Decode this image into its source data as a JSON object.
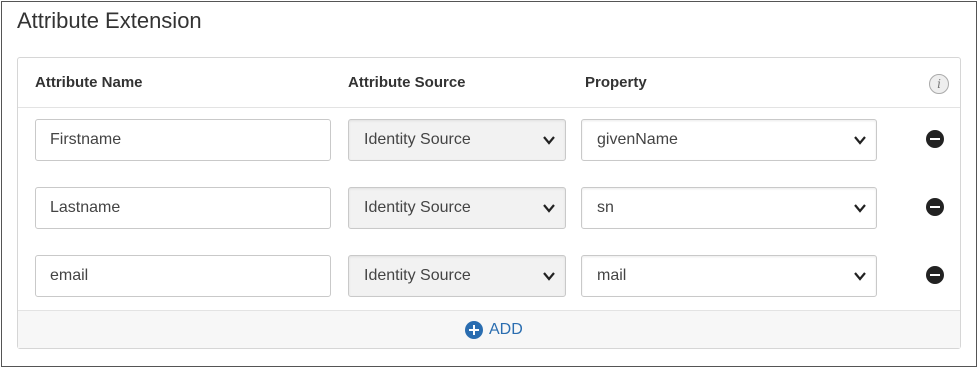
{
  "section": {
    "title": "Attribute Extension"
  },
  "table": {
    "headers": {
      "name": "Attribute Name",
      "source": "Attribute Source",
      "property": "Property"
    },
    "info_icon": {
      "icon": "info-icon",
      "glyph": "i"
    },
    "rows": [
      {
        "name": "Firstname",
        "source": "Identity Source",
        "property": "givenName"
      },
      {
        "name": "Lastname",
        "source": "Identity Source",
        "property": "sn"
      },
      {
        "name": "email",
        "source": "Identity Source",
        "property": "mail"
      }
    ],
    "add_label": "ADD"
  },
  "colors": {
    "accent": "#2a6db0",
    "remove": "#222222"
  }
}
